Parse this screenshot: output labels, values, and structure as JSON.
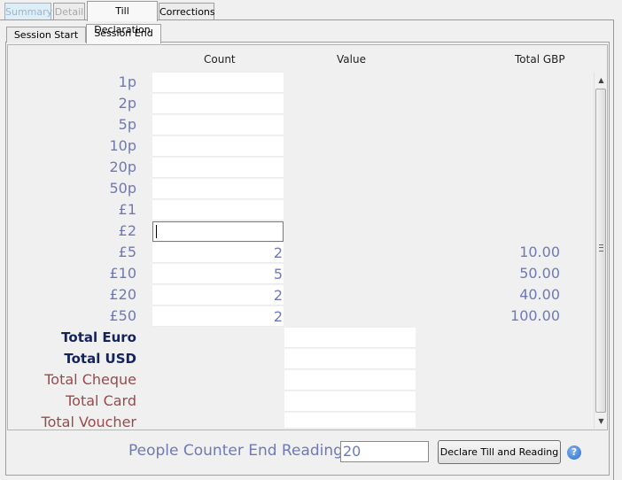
{
  "tabs": [
    {
      "label": "Summary"
    },
    {
      "label": "Detail"
    },
    {
      "label": "Till Declaration"
    },
    {
      "label": "Corrections"
    }
  ],
  "subtabs": [
    {
      "label": "Session Start"
    },
    {
      "label": "Session End"
    }
  ],
  "columns": {
    "count": "Count",
    "value": "Value",
    "total": "Total GBP"
  },
  "denominations": [
    {
      "label": "1p",
      "count": "",
      "total": ""
    },
    {
      "label": "2p",
      "count": "",
      "total": ""
    },
    {
      "label": "5p",
      "count": "",
      "total": ""
    },
    {
      "label": "10p",
      "count": "",
      "total": ""
    },
    {
      "label": "20p",
      "count": "",
      "total": ""
    },
    {
      "label": "50p",
      "count": "",
      "total": ""
    },
    {
      "label": "£1",
      "count": "",
      "total": ""
    },
    {
      "label": "£2",
      "count": "",
      "total": ""
    },
    {
      "label": "£5",
      "count": "2",
      "total": "10.00"
    },
    {
      "label": "£10",
      "count": "5",
      "total": "50.00"
    },
    {
      "label": "£20",
      "count": "2",
      "total": "40.00"
    },
    {
      "label": "£50",
      "count": "2",
      "total": "100.00"
    }
  ],
  "other_totals": [
    {
      "label": "Total Euro",
      "value": ""
    },
    {
      "label": "Total USD",
      "value": ""
    },
    {
      "label": "Total Cheque",
      "value": ""
    },
    {
      "label": "Total Card",
      "value": ""
    },
    {
      "label": "Total Voucher",
      "value": ""
    }
  ],
  "people_counter": {
    "label": "People Counter End Reading",
    "value": "20"
  },
  "declare_button": "Declare Till and Reading",
  "help_glyph": "?",
  "scrollbar": {
    "up_glyph": "▲",
    "down_glyph": "▼"
  },
  "colors": {
    "label": "#6f79b5",
    "bold_label": "#14235a",
    "red_label": "#9a4a4a"
  }
}
